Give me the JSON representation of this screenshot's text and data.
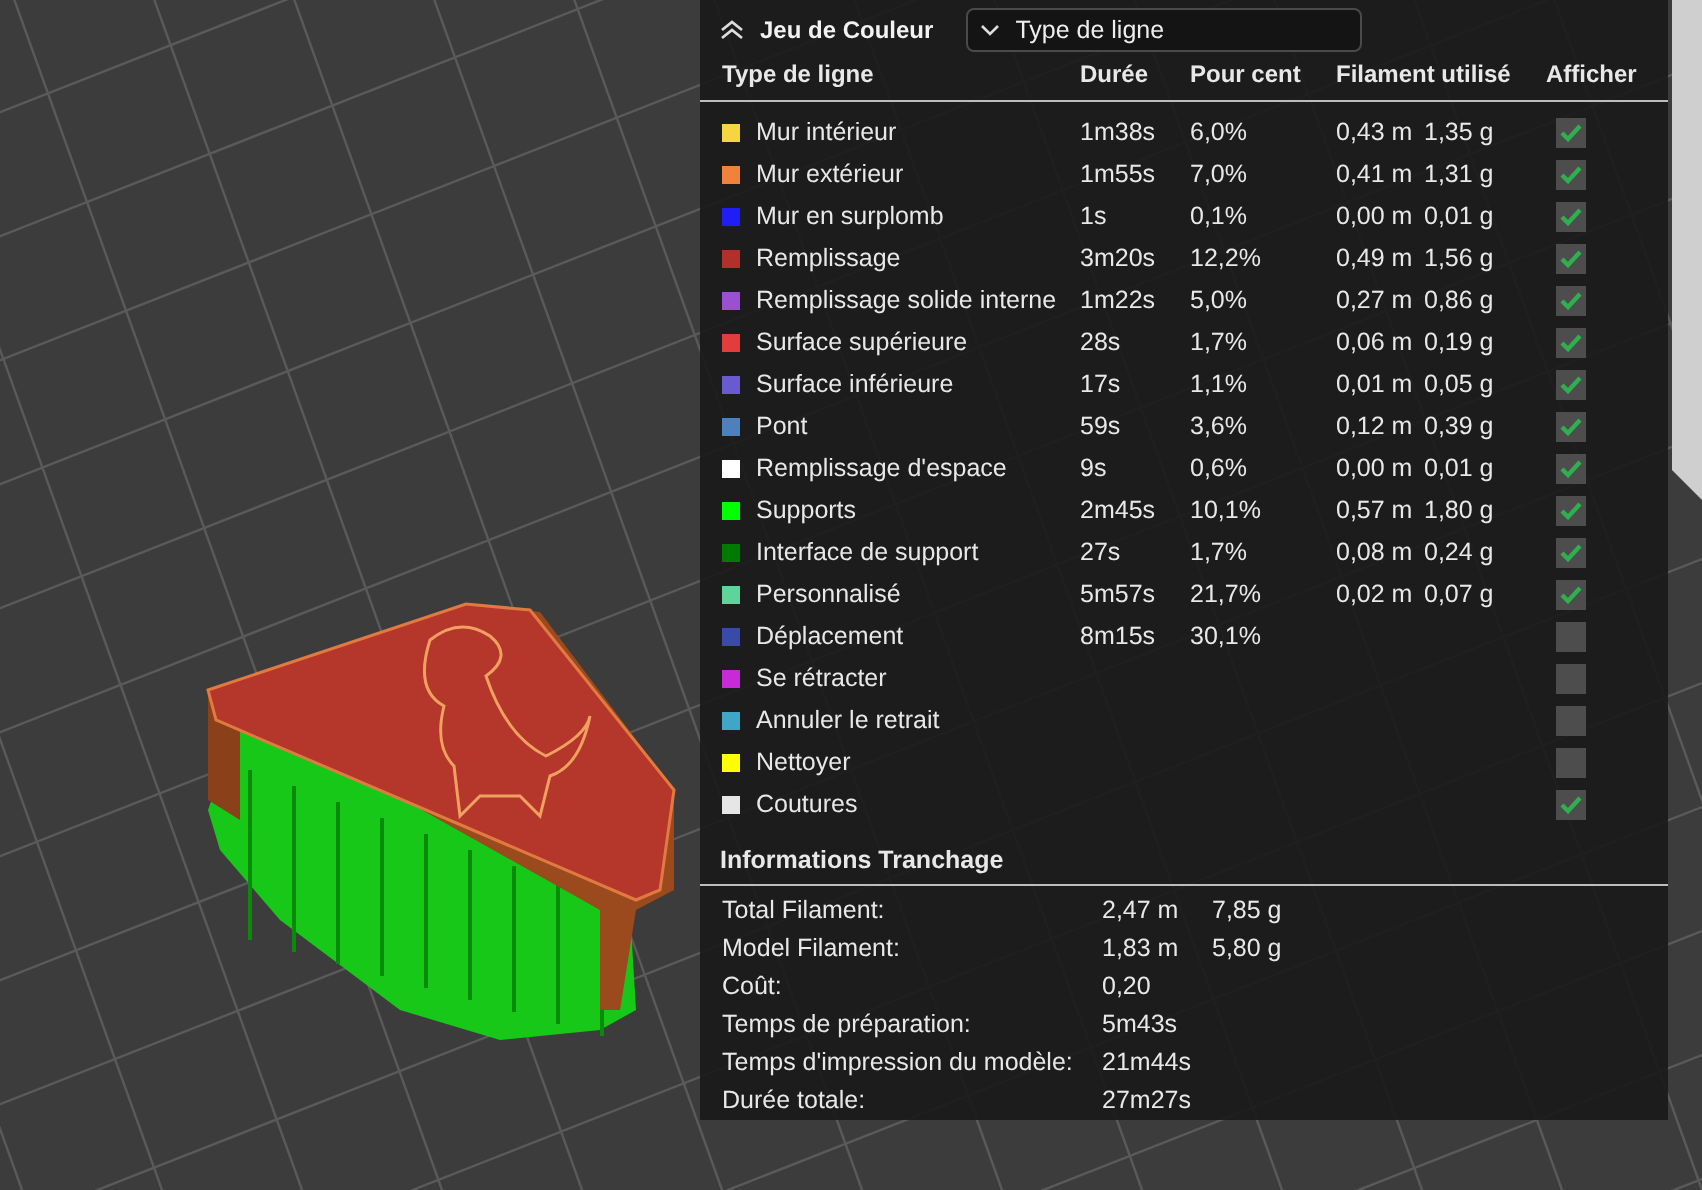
{
  "panel": {
    "title": "Jeu de Couleur",
    "expanded": true,
    "view_select": {
      "value": "Type de ligne"
    }
  },
  "table": {
    "columns": [
      "Type de ligne",
      "Durée",
      "Pour cent",
      "Filament utilisé",
      "Afficher"
    ],
    "rows": [
      {
        "name": "Mur intérieur",
        "color": "#f5d640",
        "duration": "1m38s",
        "percent": "6,0%",
        "length": "0,43 m",
        "weight": "1,35 g",
        "shown": true
      },
      {
        "name": "Mur extérieur",
        "color": "#f0823c",
        "duration": "1m55s",
        "percent": "7,0%",
        "length": "0,41 m",
        "weight": "1,31 g",
        "shown": true
      },
      {
        "name": "Mur en surplomb",
        "color": "#1f1ff5",
        "duration": "1s",
        "percent": "0,1%",
        "length": "0,00 m",
        "weight": "0,01 g",
        "shown": true
      },
      {
        "name": "Remplissage",
        "color": "#b0302a",
        "duration": "3m20s",
        "percent": "12,2%",
        "length": "0,49 m",
        "weight": "1,56 g",
        "shown": true
      },
      {
        "name": "Remplissage solide interne",
        "color": "#9a50d0",
        "duration": "1m22s",
        "percent": "5,0%",
        "length": "0,27 m",
        "weight": "0,86 g",
        "shown": true
      },
      {
        "name": "Surface supérieure",
        "color": "#e33c3c",
        "duration": "28s",
        "percent": "1,7%",
        "length": "0,06 m",
        "weight": "0,19 g",
        "shown": true
      },
      {
        "name": "Surface inférieure",
        "color": "#6a5ad0",
        "duration": "17s",
        "percent": "1,1%",
        "length": "0,01 m",
        "weight": "0,05 g",
        "shown": true
      },
      {
        "name": "Pont",
        "color": "#4d80bd",
        "duration": "59s",
        "percent": "3,6%",
        "length": "0,12 m",
        "weight": "0,39 g",
        "shown": true
      },
      {
        "name": "Remplissage d'espace",
        "color": "#ffffff",
        "duration": "9s",
        "percent": "0,6%",
        "length": "0,00 m",
        "weight": "0,01 g",
        "shown": true
      },
      {
        "name": "Supports",
        "color": "#00ff00",
        "duration": "2m45s",
        "percent": "10,1%",
        "length": "0,57 m",
        "weight": "1,80 g",
        "shown": true
      },
      {
        "name": "Interface de support",
        "color": "#007a00",
        "duration": "27s",
        "percent": "1,7%",
        "length": "0,08 m",
        "weight": "0,24 g",
        "shown": true
      },
      {
        "name": "Personnalisé",
        "color": "#5fd49a",
        "duration": "5m57s",
        "percent": "21,7%",
        "length": "0,02 m",
        "weight": "0,07 g",
        "shown": true
      },
      {
        "name": "Déplacement",
        "color": "#3a4aa8",
        "duration": "8m15s",
        "percent": "30,1%",
        "shown": false
      },
      {
        "name": "Se rétracter",
        "color": "#c72bd6",
        "shown": false
      },
      {
        "name": "Annuler le retrait",
        "color": "#3fa6c8",
        "shown": false
      },
      {
        "name": "Nettoyer",
        "color": "#ffff00",
        "shown": false
      },
      {
        "name": "Coutures",
        "color": "#e6e6e6",
        "shown": true
      }
    ]
  },
  "slicing_info": {
    "title": "Informations Tranchage",
    "rows": [
      {
        "label": "Total Filament:",
        "value": "2,47 m",
        "value_2": "7,85 g"
      },
      {
        "label": "Model Filament:",
        "value": "1,83 m",
        "value_2": "5,80 g"
      },
      {
        "label": "Coût:",
        "value": "0,20"
      },
      {
        "label": "Temps de préparation:",
        "value": "5m43s"
      },
      {
        "label": "Temps d'impression du modèle:",
        "value": "21m44s"
      },
      {
        "label": "Durée totale:",
        "value": "27m27s"
      }
    ]
  }
}
